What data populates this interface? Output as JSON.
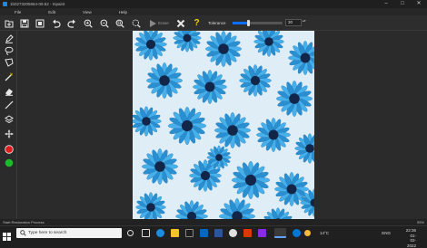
{
  "window": {
    "title": "1b0273205664-09.52 - Inpaint",
    "controls": [
      "–",
      "□",
      "✕"
    ]
  },
  "menu": [
    "File",
    "Edit",
    "View",
    "Help"
  ],
  "toolbar": {
    "erase_label": "Erase",
    "tolerance_label": "Tolerance",
    "tolerance_value": "30",
    "tolerance_fraction": 0.3,
    "spin": "▴▾"
  },
  "colors": {
    "red_marker": "#e01b1b",
    "green_marker": "#1cbb2c",
    "accent": "#0d6efd"
  },
  "icons": {
    "toolbar": [
      "open-icon",
      "save-icon",
      "save-as-icon",
      "undo-icon",
      "redo-icon",
      "zoom-in-icon",
      "zoom-out-icon",
      "zoom-fit-icon",
      "zoom-actual-icon",
      "erase-play-icon",
      "clear-x-icon",
      "help-question-icon"
    ],
    "sidebar": [
      "marker-icon",
      "lasso-icon",
      "polygon-lasso-icon",
      "magic-wand-icon",
      "eraser-icon",
      "line-icon",
      "layers-icon",
      "move-icon",
      "red-color-icon",
      "green-color-icon"
    ]
  },
  "status": {
    "message": "Start Restoration Process",
    "zoom": "55%"
  },
  "taskbar": {
    "search_placeholder": "Type here to search",
    "weather": "14°C",
    "language": "ENG",
    "time": "22:36",
    "date": "01-02-2022"
  }
}
